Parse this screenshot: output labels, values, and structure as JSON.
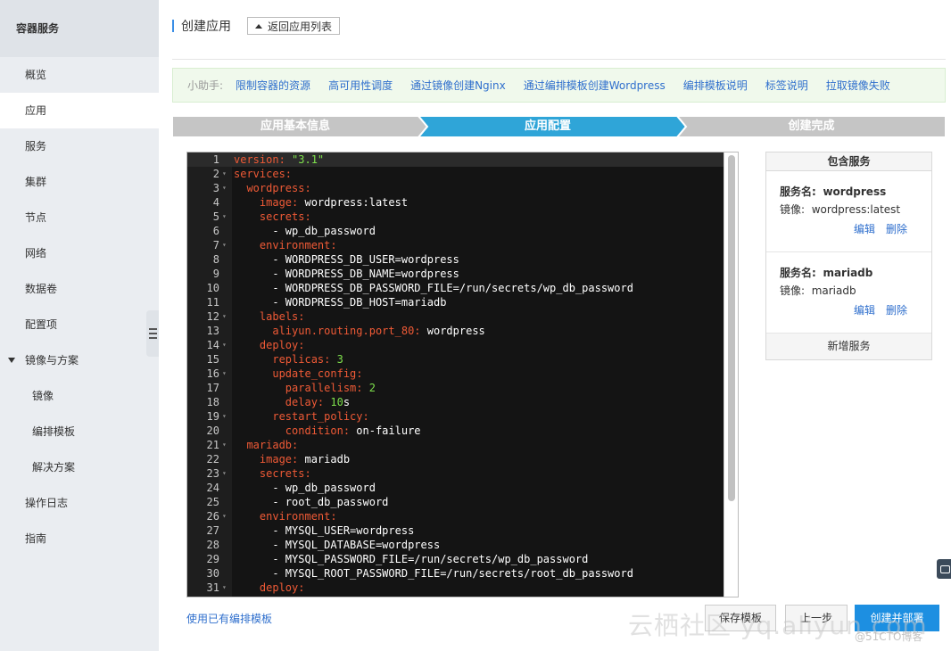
{
  "sidebar": {
    "title": "容器服务",
    "items": [
      {
        "label": "概览",
        "active": false,
        "sub": false
      },
      {
        "label": "应用",
        "active": true,
        "sub": false
      },
      {
        "label": "服务",
        "active": false,
        "sub": false
      },
      {
        "label": "集群",
        "active": false,
        "sub": false
      },
      {
        "label": "节点",
        "active": false,
        "sub": false
      },
      {
        "label": "网络",
        "active": false,
        "sub": false
      },
      {
        "label": "数据卷",
        "active": false,
        "sub": false
      },
      {
        "label": "配置项",
        "active": false,
        "sub": false
      },
      {
        "label": "镜像与方案",
        "active": false,
        "sub": false,
        "group": true
      },
      {
        "label": "镜像",
        "active": false,
        "sub": true
      },
      {
        "label": "编排模板",
        "active": false,
        "sub": true
      },
      {
        "label": "解决方案",
        "active": false,
        "sub": true
      },
      {
        "label": "操作日志",
        "active": false,
        "sub": false
      },
      {
        "label": "指南",
        "active": false,
        "sub": false
      }
    ]
  },
  "header": {
    "title": "创建应用",
    "back_label": "返回应用列表"
  },
  "helper": {
    "label": "小助手:",
    "links": [
      "限制容器的资源",
      "高可用性调度",
      "通过镜像创建Nginx",
      "通过编排模板创建Wordpress",
      "编排模板说明",
      "标签说明",
      "拉取镜像失败"
    ]
  },
  "steps": {
    "items": [
      "应用基本信息",
      "应用配置",
      "创建完成"
    ],
    "active_index": 1,
    "colors": {
      "inactive": "#c5c5c5",
      "active": "#2fa5d8"
    }
  },
  "editor": {
    "lines": [
      {
        "n": "1",
        "fold": false,
        "parts": [
          [
            "k",
            "version: "
          ],
          [
            "n",
            "\"3.1\""
          ]
        ]
      },
      {
        "n": "2",
        "fold": true,
        "parts": [
          [
            "k",
            "services:"
          ]
        ]
      },
      {
        "n": "3",
        "fold": true,
        "parts": [
          [
            "d",
            "  "
          ],
          [
            "k",
            "wordpress:"
          ]
        ]
      },
      {
        "n": "4",
        "fold": false,
        "parts": [
          [
            "d",
            "    "
          ],
          [
            "k",
            "image: "
          ],
          [
            "v",
            "wordpress:latest"
          ]
        ]
      },
      {
        "n": "5",
        "fold": true,
        "parts": [
          [
            "d",
            "    "
          ],
          [
            "k",
            "secrets:"
          ]
        ]
      },
      {
        "n": "6",
        "fold": false,
        "parts": [
          [
            "d",
            "      "
          ],
          [
            "v",
            "- wp_db_password"
          ]
        ]
      },
      {
        "n": "7",
        "fold": true,
        "parts": [
          [
            "d",
            "    "
          ],
          [
            "k",
            "environment:"
          ]
        ]
      },
      {
        "n": "8",
        "fold": false,
        "parts": [
          [
            "d",
            "      "
          ],
          [
            "v",
            "- WORDPRESS_DB_USER=wordpress"
          ]
        ]
      },
      {
        "n": "9",
        "fold": false,
        "parts": [
          [
            "d",
            "      "
          ],
          [
            "v",
            "- WORDPRESS_DB_NAME=wordpress"
          ]
        ]
      },
      {
        "n": "10",
        "fold": false,
        "parts": [
          [
            "d",
            "      "
          ],
          [
            "v",
            "- WORDPRESS_DB_PASSWORD_FILE=/run/secrets/wp_db_password"
          ]
        ]
      },
      {
        "n": "11",
        "fold": false,
        "parts": [
          [
            "d",
            "      "
          ],
          [
            "v",
            "- WORDPRESS_DB_HOST=mariadb"
          ]
        ]
      },
      {
        "n": "12",
        "fold": true,
        "parts": [
          [
            "d",
            "    "
          ],
          [
            "k",
            "labels:"
          ]
        ]
      },
      {
        "n": "13",
        "fold": false,
        "parts": [
          [
            "d",
            "      "
          ],
          [
            "k",
            "aliyun.routing.port_80: "
          ],
          [
            "v",
            "wordpress"
          ]
        ]
      },
      {
        "n": "14",
        "fold": true,
        "parts": [
          [
            "d",
            "    "
          ],
          [
            "k",
            "deploy:"
          ]
        ]
      },
      {
        "n": "15",
        "fold": false,
        "parts": [
          [
            "d",
            "      "
          ],
          [
            "k",
            "replicas: "
          ],
          [
            "n",
            "3"
          ]
        ]
      },
      {
        "n": "16",
        "fold": true,
        "parts": [
          [
            "d",
            "      "
          ],
          [
            "k",
            "update_config:"
          ]
        ]
      },
      {
        "n": "17",
        "fold": false,
        "parts": [
          [
            "d",
            "        "
          ],
          [
            "k",
            "parallelism: "
          ],
          [
            "n",
            "2"
          ]
        ]
      },
      {
        "n": "18",
        "fold": false,
        "parts": [
          [
            "d",
            "        "
          ],
          [
            "k",
            "delay: "
          ],
          [
            "n",
            "10"
          ],
          [
            "v",
            "s"
          ]
        ]
      },
      {
        "n": "19",
        "fold": true,
        "parts": [
          [
            "d",
            "      "
          ],
          [
            "k",
            "restart_policy:"
          ]
        ]
      },
      {
        "n": "20",
        "fold": false,
        "parts": [
          [
            "d",
            "        "
          ],
          [
            "k",
            "condition: "
          ],
          [
            "v",
            "on-failure"
          ]
        ]
      },
      {
        "n": "21",
        "fold": true,
        "parts": [
          [
            "d",
            "  "
          ],
          [
            "k",
            "mariadb:"
          ]
        ]
      },
      {
        "n": "22",
        "fold": false,
        "parts": [
          [
            "d",
            "    "
          ],
          [
            "k",
            "image: "
          ],
          [
            "v",
            "mariadb"
          ]
        ]
      },
      {
        "n": "23",
        "fold": true,
        "parts": [
          [
            "d",
            "    "
          ],
          [
            "k",
            "secrets:"
          ]
        ]
      },
      {
        "n": "24",
        "fold": false,
        "parts": [
          [
            "d",
            "      "
          ],
          [
            "v",
            "- wp_db_password"
          ]
        ]
      },
      {
        "n": "25",
        "fold": false,
        "parts": [
          [
            "d",
            "      "
          ],
          [
            "v",
            "- root_db_password"
          ]
        ]
      },
      {
        "n": "26",
        "fold": true,
        "parts": [
          [
            "d",
            "    "
          ],
          [
            "k",
            "environment:"
          ]
        ]
      },
      {
        "n": "27",
        "fold": false,
        "parts": [
          [
            "d",
            "      "
          ],
          [
            "v",
            "- MYSQL_USER=wordpress"
          ]
        ]
      },
      {
        "n": "28",
        "fold": false,
        "parts": [
          [
            "d",
            "      "
          ],
          [
            "v",
            "- MYSQL_DATABASE=wordpress"
          ]
        ]
      },
      {
        "n": "29",
        "fold": false,
        "parts": [
          [
            "d",
            "      "
          ],
          [
            "v",
            "- MYSQL_PASSWORD_FILE=/run/secrets/wp_db_password"
          ]
        ]
      },
      {
        "n": "30",
        "fold": false,
        "parts": [
          [
            "d",
            "      "
          ],
          [
            "v",
            "- MYSQL_ROOT_PASSWORD_FILE=/run/secrets/root_db_password"
          ]
        ]
      },
      {
        "n": "31",
        "fold": true,
        "parts": [
          [
            "d",
            "    "
          ],
          [
            "k",
            "deploy:"
          ]
        ]
      }
    ]
  },
  "services_panel": {
    "title": "包含服务",
    "name_label": "服务名:",
    "image_label": "镜像:",
    "edit_label": "编辑",
    "delete_label": "删除",
    "add_label": "新增服务",
    "services": [
      {
        "name": "wordpress",
        "image": "wordpress:latest"
      },
      {
        "name": "mariadb",
        "image": "mariadb"
      }
    ]
  },
  "footer": {
    "use_template_link": "使用已有编排模板",
    "save_template_label": "保存模板",
    "prev_label": "上一步",
    "create_deploy_label": "创建并部署"
  },
  "watermark": {
    "main": "云栖社区 yq.aliyun.com",
    "sub": "@51CTO博客"
  },
  "icons": [
    "up-arrow-icon",
    "caret-down-icon",
    "collapse-menu-icon",
    "chat-icon",
    "fold-arrow-icon"
  ]
}
